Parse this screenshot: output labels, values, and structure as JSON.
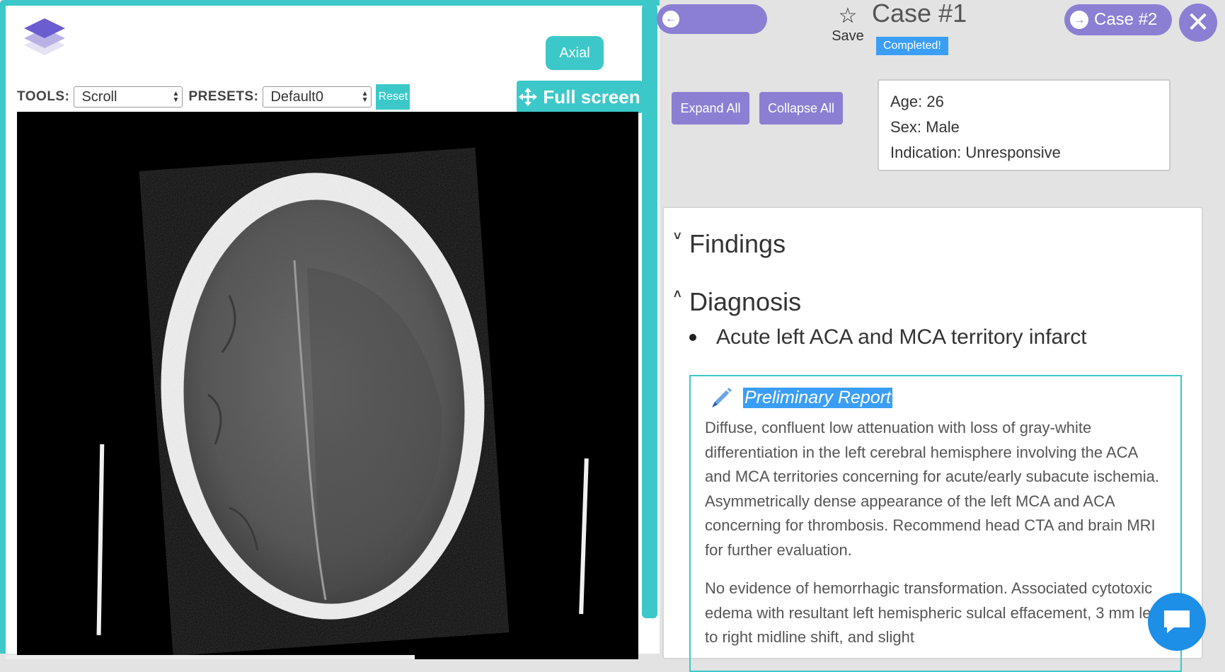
{
  "viewer": {
    "view_label": "Axial",
    "tools_label": "TOOLS:",
    "tools_value": "Scroll",
    "presets_label": "PRESETS:",
    "presets_value": "Default0",
    "reset_label": "Reset",
    "fullscreen_label": "Full screen"
  },
  "header": {
    "save_label": "Save",
    "case_title": "Case #1",
    "status": "Completed!",
    "next_case_label": "Case #2"
  },
  "actions": {
    "expand_all": "Expand All",
    "collapse_all": "Collapse All"
  },
  "patient": {
    "age": "Age: 26",
    "sex": "Sex: Male",
    "indication": "Indication: Unresponsive"
  },
  "report": {
    "findings_title": "Findings",
    "diagnosis_title": "Diagnosis",
    "diagnosis_items": [
      "Acute left ACA and MCA territory infarct"
    ],
    "preliminary_title": "Preliminary Report",
    "preliminary_paragraphs": [
      "Diffuse, confluent low attenuation with loss of gray-white differentiation in the left cerebral hemisphere involving the ACA and MCA territories concerning for acute/early subacute ischemia. Asymmetrically dense appearance of the left MCA and ACA concerning for thrombosis. Recommend head CTA and brain MRI for further evaluation.",
      "No evidence of hemorrhagic transformation. Associated cytotoxic edema with resultant left hemispheric sulcal effacement, 3 mm left to right midline shift, and slight"
    ]
  },
  "icons": {
    "back": "arrow-left-circle-icon",
    "save": "star-outline-icon",
    "next": "arrow-right-circle-icon",
    "close": "close-icon",
    "fullscreen": "move-arrows-icon",
    "pencil": "pencil-icon",
    "chat": "chat-bubble-icon"
  },
  "colors": {
    "teal": "#3cc8c8",
    "purple": "#8b7fd4",
    "blue": "#3a9ef6",
    "chat": "#1d8fe6"
  }
}
